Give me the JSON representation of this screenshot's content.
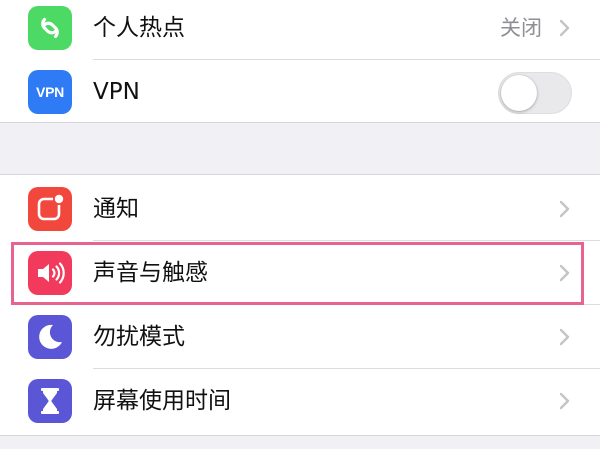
{
  "network_section": {
    "rows": [
      {
        "label": "个人热点",
        "value": "关闭",
        "icon": "hotspot-icon",
        "icon_color": "#4cd964"
      },
      {
        "label": "VPN",
        "icon": "vpn-icon",
        "icon_text": "VPN",
        "icon_color": "#2f7bf5",
        "toggle_on": false
      }
    ]
  },
  "notification_section": {
    "rows": [
      {
        "label": "通知",
        "icon": "notification-icon",
        "icon_color": "#f2473d"
      },
      {
        "label": "声音与触感",
        "icon": "speaker-icon",
        "icon_color": "#f23b5c"
      },
      {
        "label": "勿扰模式",
        "icon": "moon-icon",
        "icon_color": "#5a56d6"
      },
      {
        "label": "屏幕使用时间",
        "icon": "hourglass-icon",
        "icon_color": "#5a56d6"
      }
    ]
  },
  "highlight": {
    "target": "声音与触感",
    "color": "#e8638d"
  }
}
